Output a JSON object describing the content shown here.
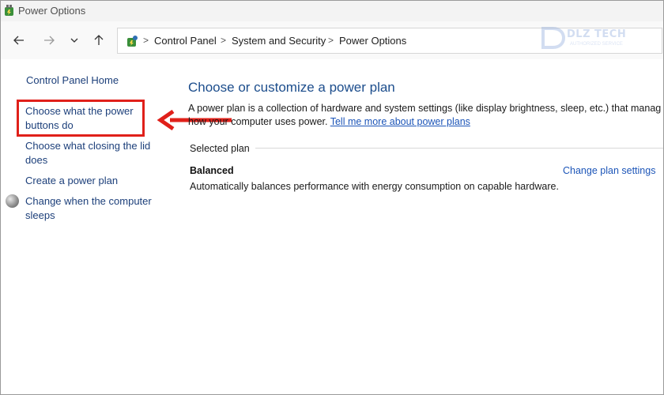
{
  "window": {
    "title": "Power Options"
  },
  "breadcrumb": [
    "Control Panel",
    "System and Security",
    "Power Options"
  ],
  "watermark": {
    "text": "DLZ TECH",
    "sub": "AUTHORIZED SERVICE"
  },
  "sidebar": {
    "home": "Control Panel Home",
    "items": [
      {
        "line1": "Choose what the power",
        "line2": "buttons do"
      },
      {
        "line1": "Choose what closing the lid",
        "line2": "does"
      },
      {
        "line1": "Create a power plan",
        "line2": ""
      },
      {
        "line1": "Change when the computer",
        "line2": "sleeps"
      }
    ]
  },
  "main": {
    "title": "Choose or customize a power plan",
    "desc_line1": "A power plan is a collection of hardware and system settings (like display brightness, sleep, etc.) that manag",
    "desc_line2_prefix": "how your computer uses power.",
    "desc_link": "Tell me more about power plans",
    "section_label": "Selected plan",
    "plan_name": "Balanced",
    "plan_settings_link": "Change plan settings",
    "plan_description": "Automatically balances performance with energy consumption on capable hardware."
  },
  "colors": {
    "link": "#1c55b8",
    "title": "#1c4d8c",
    "highlight": "#e0201a"
  }
}
